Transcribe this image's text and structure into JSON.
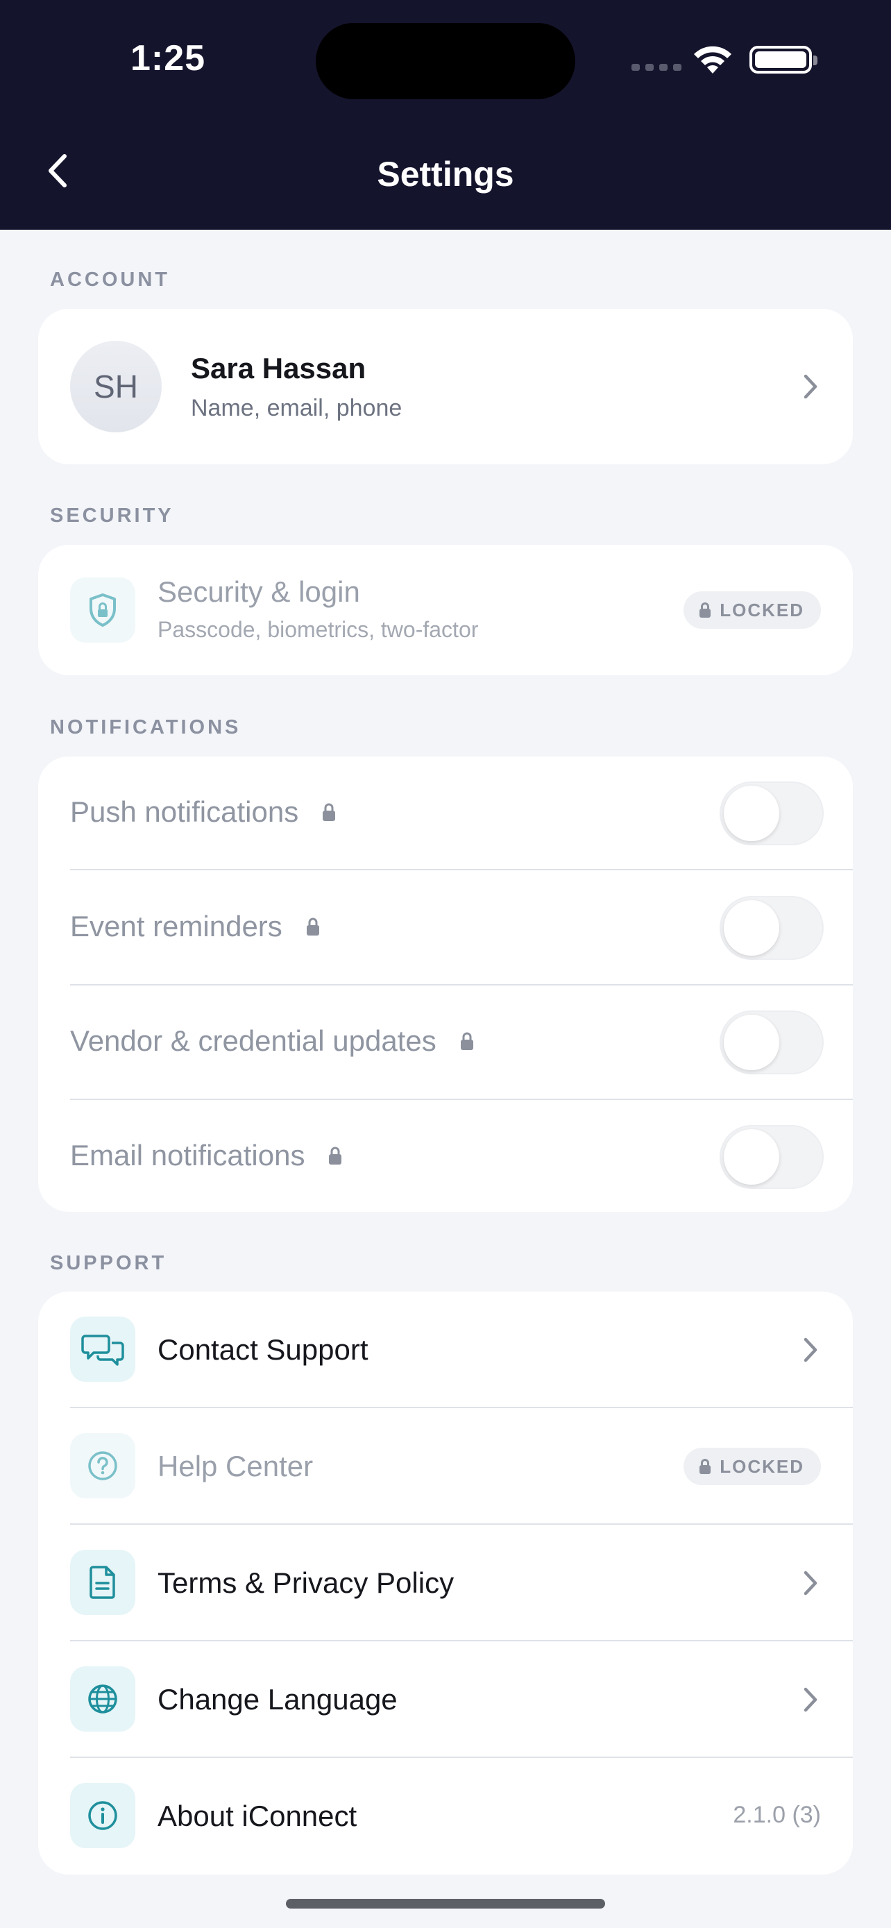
{
  "status_bar": {
    "time": "1:25"
  },
  "header": {
    "title": "Settings"
  },
  "account": {
    "section_label": "ACCOUNT",
    "initials": "SH",
    "name": "Sara Hassan",
    "subtitle": "Name, email, phone"
  },
  "security": {
    "section_label": "SECURITY",
    "title": "Security & login",
    "subtitle": "Passcode, biometrics, two-factor",
    "badge": "LOCKED"
  },
  "notifications": {
    "section_label": "NOTIFICATIONS",
    "items": [
      {
        "label": "Push notifications",
        "enabled": false,
        "locked": true
      },
      {
        "label": "Event reminders",
        "enabled": false,
        "locked": true
      },
      {
        "label": "Vendor & credential updates",
        "enabled": false,
        "locked": true
      },
      {
        "label": "Email notifications",
        "enabled": false,
        "locked": true
      }
    ]
  },
  "support": {
    "section_label": "SUPPORT",
    "items": [
      {
        "label": "Contact Support",
        "icon": "chat-bubbles-icon"
      },
      {
        "label": "Help Center",
        "icon": "question-circle-icon",
        "badge": "LOCKED"
      },
      {
        "label": "Terms & Privacy Policy",
        "icon": "document-icon"
      },
      {
        "label": "Change Language",
        "icon": "globe-icon"
      },
      {
        "label": "About iConnect",
        "icon": "info-circle-icon",
        "value": "2.1.0 (3)"
      }
    ]
  },
  "colors": {
    "header_bg": "#15142d",
    "accent_teal": "#1e8f9c",
    "page_bg": "#f3f5f9"
  }
}
